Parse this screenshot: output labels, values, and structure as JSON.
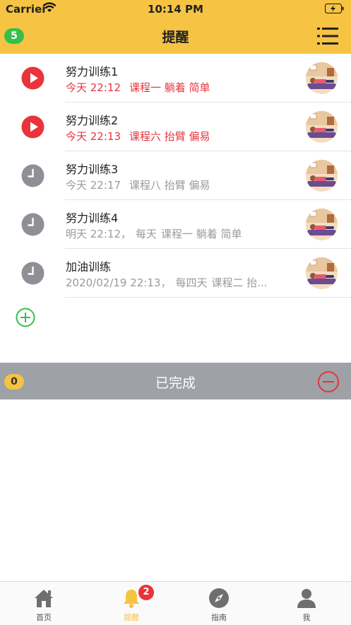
{
  "status_bar": {
    "carrier": "Carrier",
    "time": "10:14 PM"
  },
  "header": {
    "count": "5",
    "title": "提醒"
  },
  "reminders": [
    {
      "name": "努力训练1",
      "time": "今天 22:12",
      "repeat": "",
      "course": "课程一 躺着 简单",
      "state": "play"
    },
    {
      "name": "努力训练2",
      "time": "今天 22:13",
      "repeat": "",
      "course": "课程六 抬臂 偏易",
      "state": "play"
    },
    {
      "name": "努力训练3",
      "time": "今天 22:17",
      "repeat": "",
      "course": "课程八 抬臂 偏易",
      "state": "clock"
    },
    {
      "name": "努力训练4",
      "time": "明天 22:12，",
      "repeat": "每天",
      "course": "课程一 躺着 简单",
      "state": "clock"
    },
    {
      "name": "加油训练",
      "time": "2020/02/19 22:13，",
      "repeat": "每四天",
      "course": "课程二 抬...",
      "state": "clock"
    }
  ],
  "completed": {
    "count": "0",
    "title": "已完成"
  },
  "tabs": [
    {
      "label": "首页",
      "icon": "home-icon"
    },
    {
      "label": "提醒",
      "icon": "bell-icon",
      "badge": "2"
    },
    {
      "label": "指南",
      "icon": "compass-icon"
    },
    {
      "label": "我",
      "icon": "person-icon"
    }
  ],
  "colors": {
    "accent": "#f6c343",
    "alert": "#e8343a",
    "success": "#35c04c",
    "muted": "#9ea1a6"
  }
}
